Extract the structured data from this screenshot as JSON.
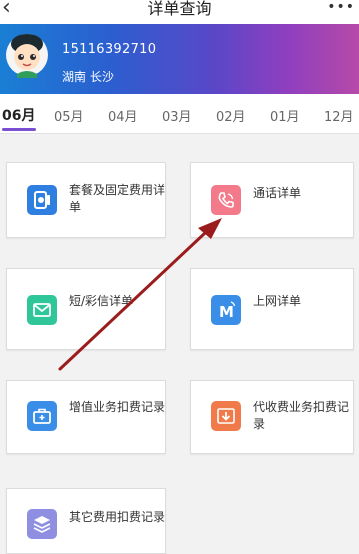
{
  "header": {
    "title": "详单查询",
    "back_glyph": "‹",
    "more_glyph": "•••"
  },
  "profile": {
    "phone": "15116392710",
    "location": "湖南 长沙"
  },
  "months": [
    "06月",
    "05月",
    "04月",
    "03月",
    "02月",
    "01月",
    "12月"
  ],
  "active_month": "06月",
  "services": [
    {
      "label": "套餐及固定费用详单",
      "icon": "package-fee-icon",
      "color": "#2f7fe0"
    },
    {
      "label": "通话详单",
      "icon": "phone-call-icon",
      "color": "#f27a8a"
    },
    {
      "label": "短/彩信详单",
      "icon": "message-envelope-icon",
      "color": "#2fc79a"
    },
    {
      "label": "上网详单",
      "icon": "internet-m-icon",
      "color": "#3b8ee8"
    },
    {
      "label": "增值业务扣费记录",
      "icon": "briefcase-icon",
      "color": "#3b8ee8"
    },
    {
      "label": "代收费业务扣费记录",
      "icon": "download-fee-icon",
      "color": "#f07a4a"
    },
    {
      "label": "其它费用扣费记录",
      "icon": "layers-icon",
      "color": "#8e8fe0"
    }
  ],
  "colors": {
    "accent": "#7b4fd1",
    "arrow": "#9b1c1c"
  }
}
